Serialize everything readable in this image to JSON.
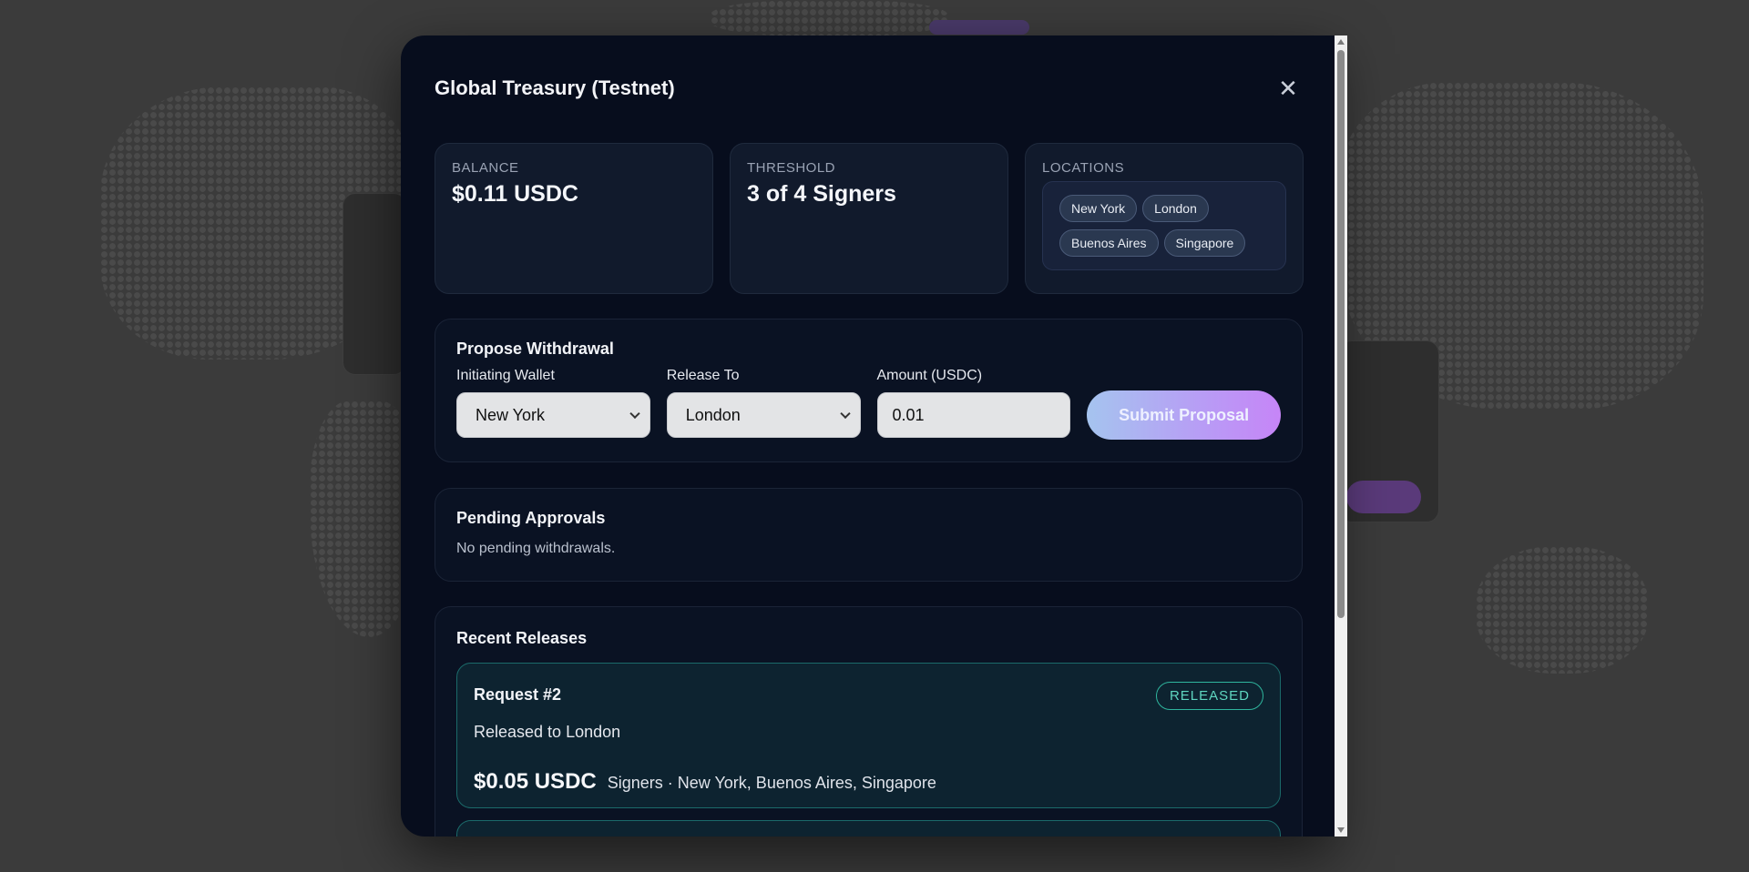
{
  "modal": {
    "title": "Global Treasury (Testnet)",
    "close_icon": "close-icon"
  },
  "stats": {
    "balance": {
      "label": "BALANCE",
      "value": "$0.11 USDC"
    },
    "threshold": {
      "label": "THRESHOLD",
      "value": "3 of 4 Signers"
    },
    "locations": {
      "label": "LOCATIONS",
      "items": [
        "New York",
        "London",
        "Buenos Aires",
        "Singapore"
      ]
    }
  },
  "withdraw": {
    "title": "Propose Withdrawal",
    "initiating_label": "Initiating Wallet",
    "initiating_value": "New York",
    "release_label": "Release To",
    "release_value": "London",
    "amount_label": "Amount (USDC)",
    "amount_value": "0.01",
    "submit_label": "Submit Proposal"
  },
  "pending": {
    "title": "Pending Approvals",
    "empty_text": "No pending withdrawals."
  },
  "releases": {
    "title": "Recent Releases",
    "items": [
      {
        "request": "Request #2",
        "status": "RELEASED",
        "description": "Released to London",
        "amount": "$0.05 USDC",
        "signers": "Signers · New York, Buenos Aires, Singapore"
      }
    ]
  },
  "colors": {
    "modal_bg": "#070d1d",
    "accent_gradient_start": "#a5c4ef",
    "accent_gradient_end": "#c685f7",
    "released_badge": "#5fd6c0"
  }
}
